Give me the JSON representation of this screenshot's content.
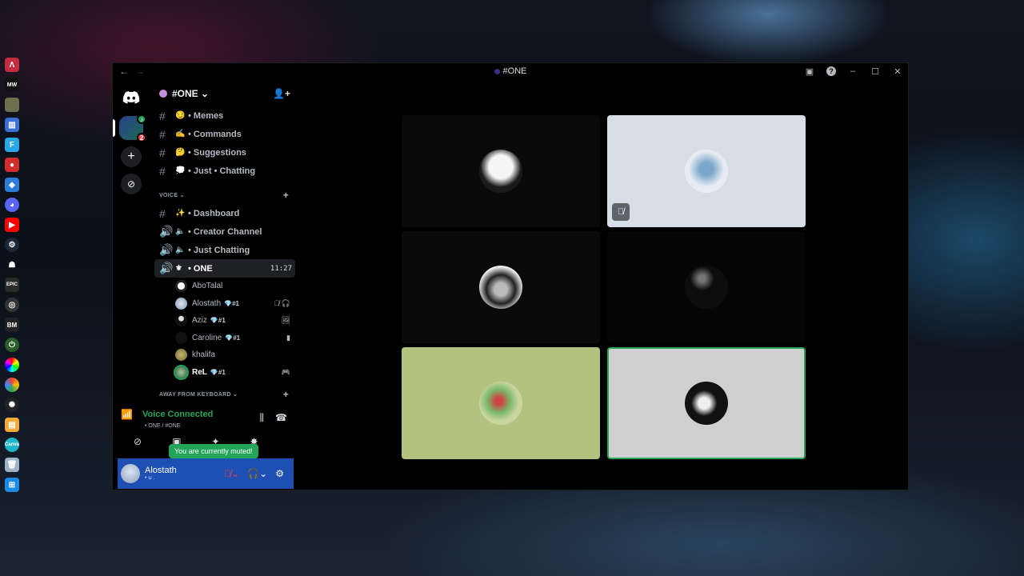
{
  "window": {
    "title": "#ONE",
    "back_arrow": "←",
    "forward_arrow": "→"
  },
  "server": {
    "name": "#ONE ⌄",
    "text_channels": [
      {
        "emoji": "😏",
        "label": "• Memes"
      },
      {
        "emoji": "✍",
        "label": "• Commands"
      },
      {
        "emoji": "🤔",
        "label": "• Suggestions"
      },
      {
        "emoji": "💭",
        "label": "• Just • Chatting"
      }
    ],
    "voice_category": "VOICE ⌄",
    "voice_channels": [
      {
        "type": "text",
        "emoji": "✨",
        "label": "• Dashboard"
      },
      {
        "type": "voice",
        "emoji": "🔈",
        "label": "•  Creator Channel"
      },
      {
        "type": "voice",
        "emoji": "🔈",
        "label": "• Just Chatting"
      },
      {
        "type": "voice",
        "emoji": "⚜",
        "label": "• ONE",
        "time": "11:27",
        "active": true
      }
    ],
    "members": [
      {
        "name": "AboTalal",
        "tag": "",
        "right": ""
      },
      {
        "name": "Alostath",
        "tag": "#1",
        "right": "🎙̸ 🎧"
      },
      {
        "name": "Aziz",
        "tag": "#1",
        "right": "🖼"
      },
      {
        "name": "Caroline",
        "tag": "#1",
        "right": "▮"
      },
      {
        "name": "khalifa",
        "tag": "",
        "right": ""
      },
      {
        "name": "ReL",
        "tag": "#1",
        "right": "🎮"
      }
    ],
    "afk_category": "AWAY FROM KEYBOARD ⌄"
  },
  "voice_panel": {
    "title": "Voice Connected",
    "subtitle": "• ONE / #ONE",
    "tooltip": "You are currently muted!"
  },
  "user_panel": {
    "name": "Alostath",
    "status": "• ⍦ ."
  },
  "colors": {
    "accent_green": "#23a559",
    "user_panel_blue": "#1e4fb3",
    "muted_red": "#f23f43"
  },
  "icons": {
    "discord_home": "discord-logo-icon",
    "invite": "add-member-icon",
    "mute": "microphone-off-icon",
    "deafen": "headphones-icon",
    "settings": "gear-icon"
  }
}
